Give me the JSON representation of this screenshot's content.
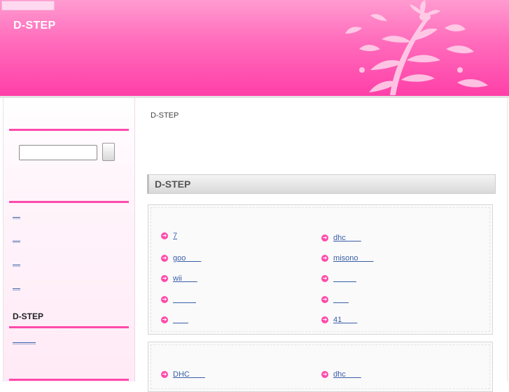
{
  "header": {
    "site_title": "D-STEP"
  },
  "sidebar": {
    "search_placeholder": "",
    "search_button_label": "",
    "links": [
      "＿",
      "＿",
      "＿",
      "＿"
    ],
    "heading": "D-STEP",
    "sub_link": "＿＿＿"
  },
  "main": {
    "breadcrumb": "D-STEP",
    "section_title": "D-STEP",
    "list1": [
      {
        "label": "7"
      },
      {
        "label": "dhc＿＿"
      },
      {
        "label": "goo＿＿"
      },
      {
        "label": "misono＿＿"
      },
      {
        "label": "wii＿＿"
      },
      {
        "label": "＿＿＿"
      },
      {
        "label": "＿＿＿"
      },
      {
        "label": "＿＿"
      },
      {
        "label": "＿＿"
      },
      {
        "label": "41＿＿"
      }
    ],
    "list2": [
      {
        "label": "DHC＿＿"
      },
      {
        "label": "dhc＿＿"
      }
    ]
  },
  "colors": {
    "accent": "#ff4aab",
    "link": "#3b5ea8",
    "header_top": "#ff9bd0",
    "header_bottom": "#ff3fa8"
  }
}
